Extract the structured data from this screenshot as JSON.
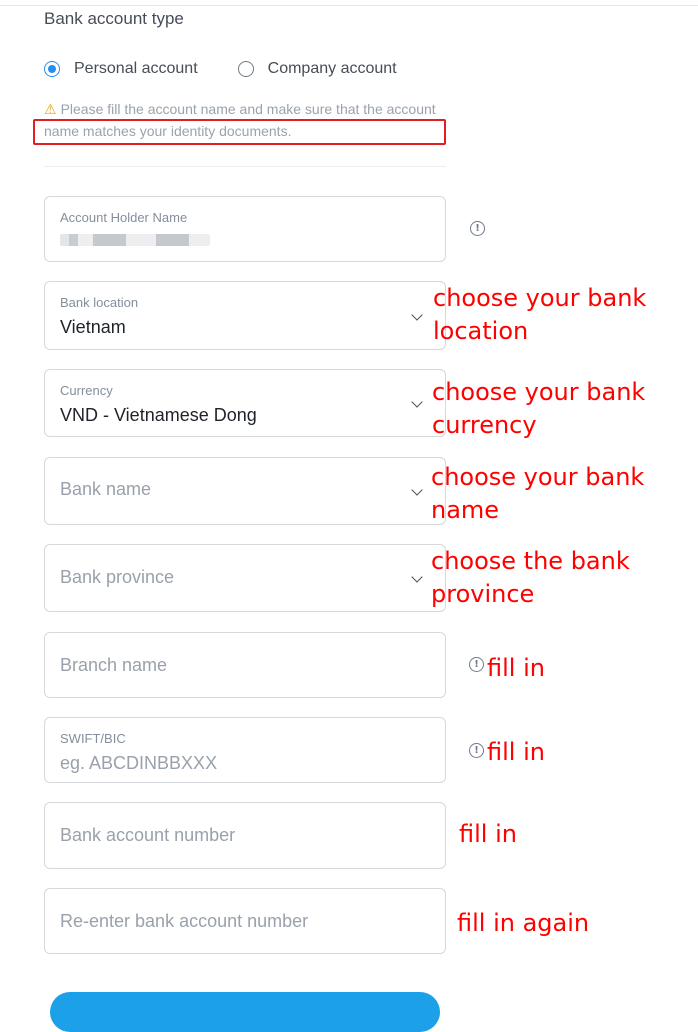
{
  "form": {
    "section_title": "Bank account type",
    "account_types": [
      {
        "label": "Personal account",
        "selected": true
      },
      {
        "label": "Company account",
        "selected": false
      }
    ],
    "notice": "Please fill the account name and make sure that the account name matches your identity documents.",
    "fields": {
      "holder": {
        "label": "Account Holder Name",
        "value": ""
      },
      "location": {
        "label": "Bank location",
        "value": "Vietnam"
      },
      "currency": {
        "label": "Currency",
        "value": "VND - Vietnamese Dong"
      },
      "bank_name": {
        "placeholder": "Bank name"
      },
      "province": {
        "placeholder": "Bank province"
      },
      "branch": {
        "placeholder": "Branch name"
      },
      "swift": {
        "label": "SWIFT/BIC",
        "placeholder": "eg. ABCDINBBXXX"
      },
      "account_number": {
        "placeholder": "Bank account number"
      },
      "reenter": {
        "placeholder": "Re-enter bank account number"
      }
    }
  },
  "annotations": {
    "location": [
      "choose your bank",
      "location"
    ],
    "currency": [
      "choose your bank",
      "currency"
    ],
    "bank_name": [
      "choose your bank",
      "name"
    ],
    "province": [
      "choose the bank",
      "province"
    ],
    "branch": "fill in",
    "swift": "fill in",
    "account_number": "fill in",
    "reenter": "fill in again"
  },
  "colors": {
    "accent": "#2b8cf0",
    "annotation": "#ff0000",
    "warning": "#f0a000",
    "button": "#1ca0e8"
  },
  "icons": {
    "warning": "warning-triangle-icon",
    "info": "info-circle-icon",
    "dropdown": "chevron-down-icon"
  }
}
